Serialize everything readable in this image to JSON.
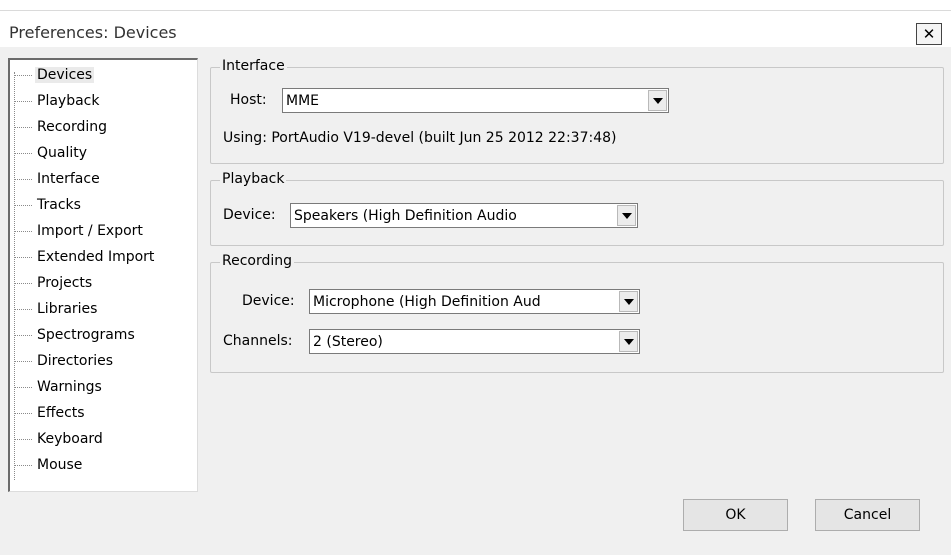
{
  "window": {
    "title": "Preferences: Devices",
    "close_label": "✕"
  },
  "tree": {
    "items": [
      {
        "label": "Devices",
        "selected": true
      },
      {
        "label": "Playback"
      },
      {
        "label": "Recording"
      },
      {
        "label": "Quality"
      },
      {
        "label": "Interface"
      },
      {
        "label": "Tracks"
      },
      {
        "label": "Import / Export"
      },
      {
        "label": "Extended Import"
      },
      {
        "label": "Projects"
      },
      {
        "label": "Libraries"
      },
      {
        "label": "Spectrograms"
      },
      {
        "label": "Directories"
      },
      {
        "label": "Warnings"
      },
      {
        "label": "Effects"
      },
      {
        "label": "Keyboard"
      },
      {
        "label": "Mouse"
      }
    ]
  },
  "interface": {
    "legend": "Interface",
    "host_label": "Host:",
    "host_value": "MME",
    "using_text": "Using: PortAudio V19-devel (built Jun 25 2012 22:37:48)"
  },
  "playback": {
    "legend": "Playback",
    "device_label": "Device:",
    "device_value": "Speakers (High Definition Audio"
  },
  "recording": {
    "legend": "Recording",
    "device_label": "Device:",
    "device_value": "Microphone (High Definition Aud",
    "channels_label": "Channels:",
    "channels_value": "2 (Stereo)"
  },
  "buttons": {
    "ok": "OK",
    "cancel": "Cancel"
  }
}
